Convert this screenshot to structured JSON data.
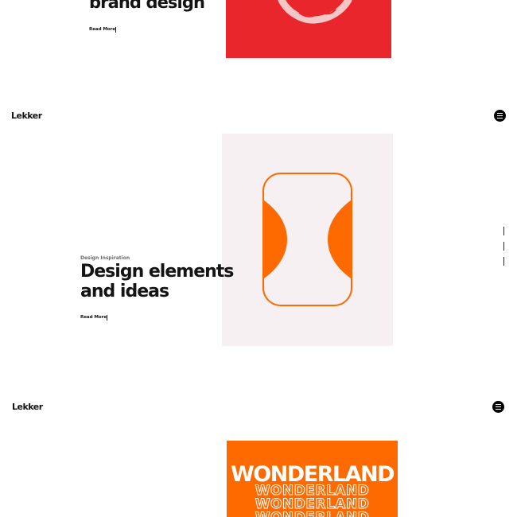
{
  "slide_one": {
    "heading": "brand design",
    "read_more": "Read More",
    "image_color": "#E8262B"
  },
  "header_one": {
    "logo": "Lekker"
  },
  "slide_two": {
    "eyebrow": "Design Inspiration",
    "title_line1": "Design elements",
    "title_line2": "and ideas",
    "read_more": "Read More",
    "image_bg": "#F7F0F3",
    "accent": "#FF6A00"
  },
  "header_two": {
    "logo": "Lekker"
  },
  "slide_three": {
    "poster_title": "WONDERLAND",
    "poster_echo": "WONDERLAND",
    "poster_bg": "#FF6A00"
  },
  "icons": {
    "menu": "hamburger-menu-icon",
    "art_one": "leaf-wreath-icon",
    "art_two": "hourglass-icon"
  }
}
